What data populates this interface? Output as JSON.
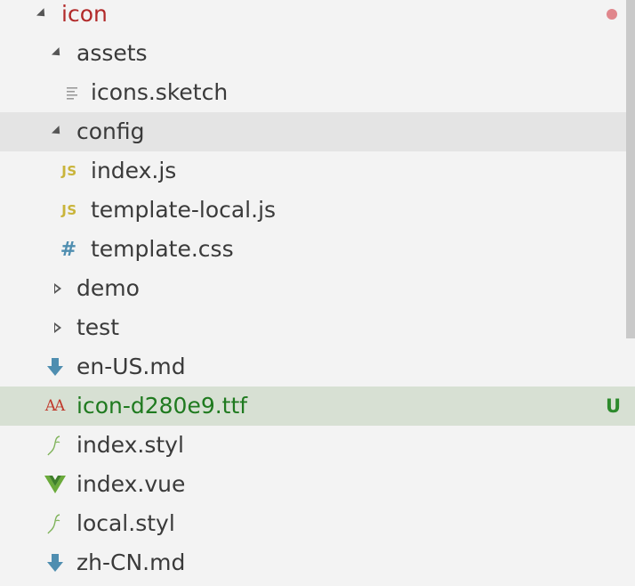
{
  "explorer": {
    "root": {
      "label": "icon",
      "expanded": true
    },
    "items": [
      {
        "label": "assets",
        "type": "folder",
        "expanded": true
      },
      {
        "label": "icons.sketch",
        "type": "file",
        "icon": "text-lines-icon"
      },
      {
        "label": "config",
        "type": "folder",
        "expanded": true,
        "selected": true
      },
      {
        "label": "index.js",
        "type": "file",
        "icon": "js-icon",
        "icon_text": "JS"
      },
      {
        "label": "template-local.js",
        "type": "file",
        "icon": "js-icon",
        "icon_text": "JS"
      },
      {
        "label": "template.css",
        "type": "file",
        "icon": "hash-icon",
        "icon_text": "#"
      },
      {
        "label": "demo",
        "type": "folder",
        "expanded": false
      },
      {
        "label": "test",
        "type": "folder",
        "expanded": false
      },
      {
        "label": "en-US.md",
        "type": "file",
        "icon": "download-arrow-icon"
      },
      {
        "label": "icon-d280e9.ttf",
        "type": "file",
        "icon": "font-icon",
        "icon_text": "AA",
        "git_status": "U"
      },
      {
        "label": "index.styl",
        "type": "file",
        "icon": "stylus-icon"
      },
      {
        "label": "index.vue",
        "type": "file",
        "icon": "vue-icon"
      },
      {
        "label": "local.styl",
        "type": "file",
        "icon": "stylus-icon"
      },
      {
        "label": "zh-CN.md",
        "type": "file",
        "icon": "download-arrow-icon"
      }
    ]
  },
  "colors": {
    "root_folder": "#b22a2a",
    "untracked_text": "#1f7a1f",
    "js_icon": "#c9b43a",
    "css_icon": "#4f8eb0",
    "markdown_icon": "#4f8eb0",
    "vue_icon": "#6aaa3a",
    "dirty_dot": "#e0868c",
    "untracked_row": "#d7e0d3",
    "selected_row": "#e4e4e4"
  }
}
